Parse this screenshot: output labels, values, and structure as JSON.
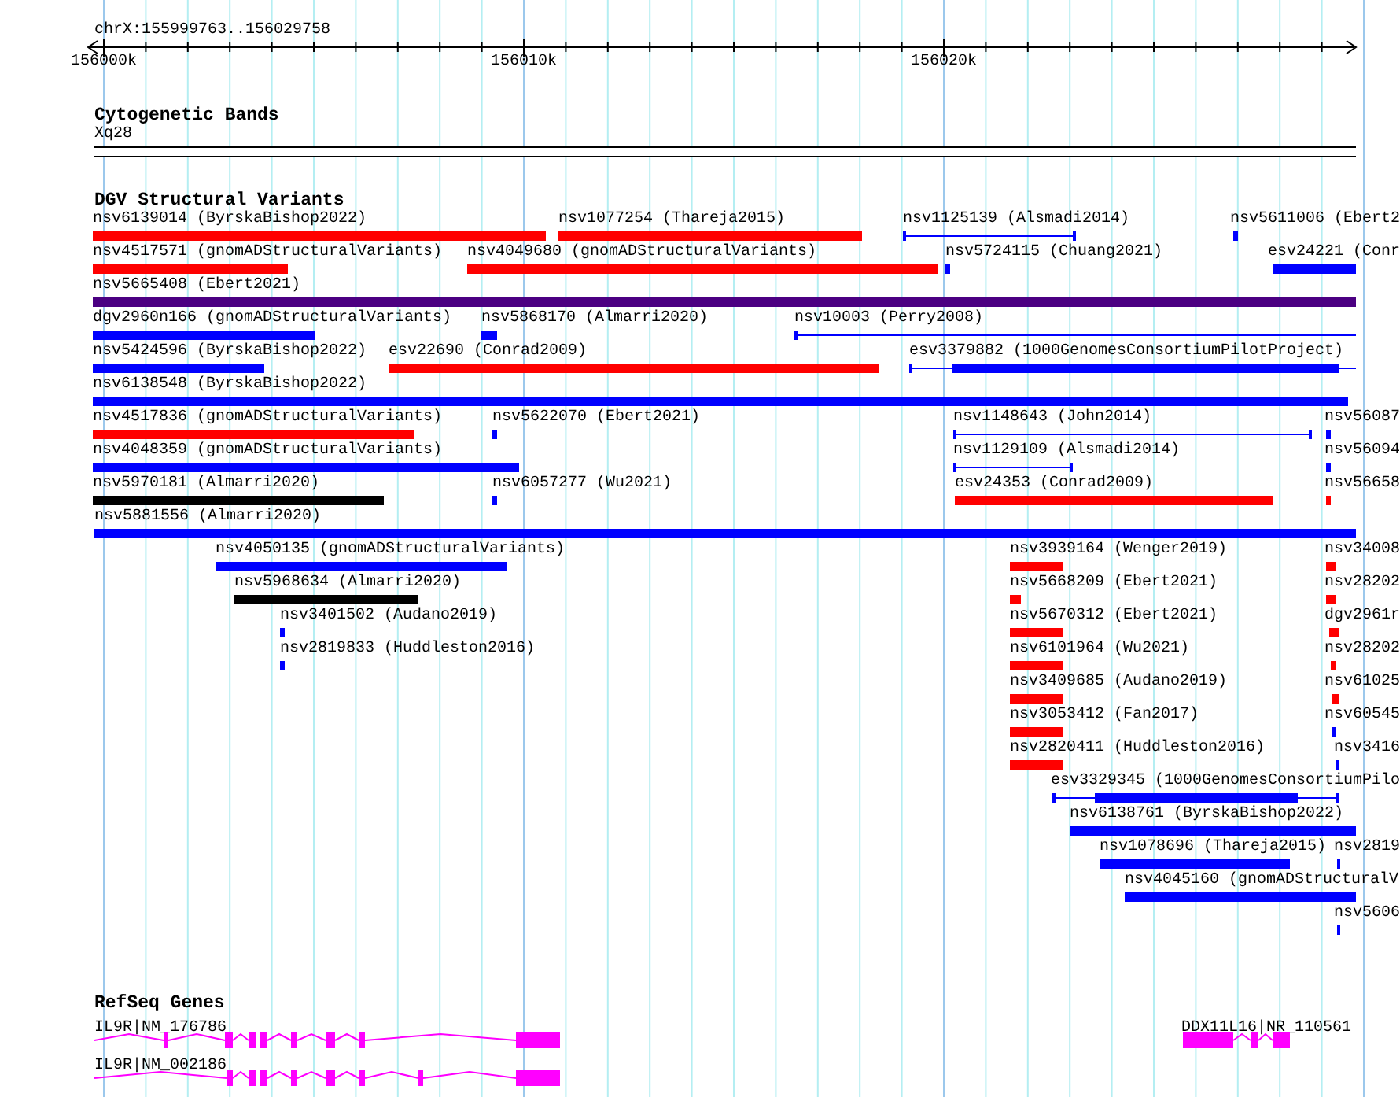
{
  "ruler": {
    "location": "chrX:155999763..156029758",
    "ticks": [
      "156000k",
      "156010k",
      "156020k"
    ]
  },
  "tracks": [
    {
      "title": "Cytogenetic Bands",
      "kind": "bands",
      "features": [
        {
          "label": "Xq28"
        }
      ]
    },
    {
      "title": "DGV Structural Variants",
      "kind": "variants",
      "features": [
        {
          "label": "nsv6139014 (ByrskaBishop2022)",
          "color": "#ff0000",
          "kind": "bar"
        },
        {
          "label": "nsv1077254 (Thareja2015)",
          "color": "#ff0000",
          "kind": "bar"
        },
        {
          "label": "nsv1125139 (Alsmadi2014)",
          "color": "#0000ff",
          "kind": "span"
        },
        {
          "label": "nsv5611006 (Ebert2",
          "color": "#0000ff",
          "kind": "bar"
        },
        {
          "label": "nsv4517571 (gnomADStructuralVariants)",
          "color": "#ff0000",
          "kind": "bar"
        },
        {
          "label": "nsv4049680 (gnomADStructuralVariants)",
          "color": "#ff0000",
          "kind": "bar"
        },
        {
          "label": "nsv5724115 (Chuang2021)",
          "color": "#0000ff",
          "kind": "bar"
        },
        {
          "label": "esv24221 (Conr",
          "color": "#0000ff",
          "kind": "bar"
        },
        {
          "label": "nsv5665408 (Ebert2021)",
          "color": "#4b0082",
          "kind": "bar"
        },
        {
          "label": "dgv2960n166 (gnomADStructuralVariants)",
          "color": "#0000ff",
          "kind": "bar"
        },
        {
          "label": "nsv5868170 (Almarri2020)",
          "color": "#0000ff",
          "kind": "bar"
        },
        {
          "label": "nsv10003 (Perry2008)",
          "color": "#0000ff",
          "kind": "span"
        },
        {
          "label": "nsv5424596 (ByrskaBishop2022)",
          "color": "#0000ff",
          "kind": "bar"
        },
        {
          "label": "esv22690 (Conrad2009)",
          "color": "#ff0000",
          "kind": "bar"
        },
        {
          "label": "esv3379882 (1000GenomesConsortiumPilotProject)",
          "color": "#0000ff",
          "kind": "span_bar"
        },
        {
          "label": "nsv6138548 (ByrskaBishop2022)",
          "color": "#0000ff",
          "kind": "bar"
        },
        {
          "label": "nsv4517836 (gnomADStructuralVariants)",
          "color": "#ff0000",
          "kind": "bar"
        },
        {
          "label": "nsv5622070 (Ebert2021)",
          "color": "#0000ff",
          "kind": "bar"
        },
        {
          "label": "nsv1148643 (John2014)",
          "color": "#0000ff",
          "kind": "span"
        },
        {
          "label": "nsv56087",
          "color": "#0000ff",
          "kind": "bar"
        },
        {
          "label": "nsv4048359 (gnomADStructuralVariants)",
          "color": "#0000ff",
          "kind": "bar"
        },
        {
          "label": "nsv1129109 (Alsmadi2014)",
          "color": "#0000ff",
          "kind": "span"
        },
        {
          "label": "nsv56094",
          "color": "#0000ff",
          "kind": "bar"
        },
        {
          "label": "nsv5970181 (Almarri2020)",
          "color": "#000000",
          "kind": "bar"
        },
        {
          "label": "nsv6057277 (Wu2021)",
          "color": "#0000ff",
          "kind": "bar"
        },
        {
          "label": "esv24353 (Conrad2009)",
          "color": "#ff0000",
          "kind": "bar"
        },
        {
          "label": "nsv56658",
          "color": "#ff0000",
          "kind": "bar"
        },
        {
          "label": "nsv5881556 (Almarri2020)",
          "color": "#0000ff",
          "kind": "bar"
        },
        {
          "label": "nsv4050135 (gnomADStructuralVariants)",
          "color": "#0000ff",
          "kind": "bar"
        },
        {
          "label": "nsv3939164 (Wenger2019)",
          "color": "#ff0000",
          "kind": "bar"
        },
        {
          "label": "nsv34008",
          "color": "#ff0000",
          "kind": "bar"
        },
        {
          "label": "nsv5968634 (Almarri2020)",
          "color": "#000000",
          "kind": "bar"
        },
        {
          "label": "nsv5668209 (Ebert2021)",
          "color": "#ff0000",
          "kind": "bar"
        },
        {
          "label": "nsv28202",
          "color": "#ff0000",
          "kind": "bar"
        },
        {
          "label": "nsv3401502 (Audano2019)",
          "color": "#0000ff",
          "kind": "bar"
        },
        {
          "label": "nsv5670312 (Ebert2021)",
          "color": "#ff0000",
          "kind": "bar"
        },
        {
          "label": "dgv2961r",
          "color": "#ff0000",
          "kind": "bar"
        },
        {
          "label": "nsv2819833 (Huddleston2016)",
          "color": "#0000ff",
          "kind": "bar"
        },
        {
          "label": "nsv6101964 (Wu2021)",
          "color": "#ff0000",
          "kind": "bar"
        },
        {
          "label": "nsv28202",
          "color": "#ff0000",
          "kind": "bar"
        },
        {
          "label": "nsv3409685 (Audano2019)",
          "color": "#ff0000",
          "kind": "bar"
        },
        {
          "label": "nsv61025",
          "color": "#ff0000",
          "kind": "bar"
        },
        {
          "label": "nsv3053412 (Fan2017)",
          "color": "#ff0000",
          "kind": "bar"
        },
        {
          "label": "nsv60545",
          "color": "#0000ff",
          "kind": "bar"
        },
        {
          "label": "nsv2820411 (Huddleston2016)",
          "color": "#ff0000",
          "kind": "bar"
        },
        {
          "label": "nsv3416",
          "color": "#0000ff",
          "kind": "bar"
        },
        {
          "label": "esv3329345 (1000GenomesConsortiumPilo",
          "color": "#0000ff",
          "kind": "span_bar"
        },
        {
          "label": "nsv6138761 (ByrskaBishop2022)",
          "color": "#0000ff",
          "kind": "bar"
        },
        {
          "label": "nsv1078696 (Thareja2015)",
          "color": "#0000ff",
          "kind": "bar"
        },
        {
          "label": "nsv2819",
          "color": "#0000ff",
          "kind": "bar"
        },
        {
          "label": "nsv4045160 (gnomADStructuralV",
          "color": "#0000ff",
          "kind": "bar"
        },
        {
          "label": "nsv5606",
          "color": "#0000ff",
          "kind": "bar"
        }
      ]
    },
    {
      "title": "RefSeq Genes",
      "kind": "genes",
      "features": [
        {
          "label": "IL9R|NM_176786"
        },
        {
          "label": "IL9R|NM_002186"
        },
        {
          "label": "DDX11L16|NR_110561"
        }
      ]
    }
  ]
}
